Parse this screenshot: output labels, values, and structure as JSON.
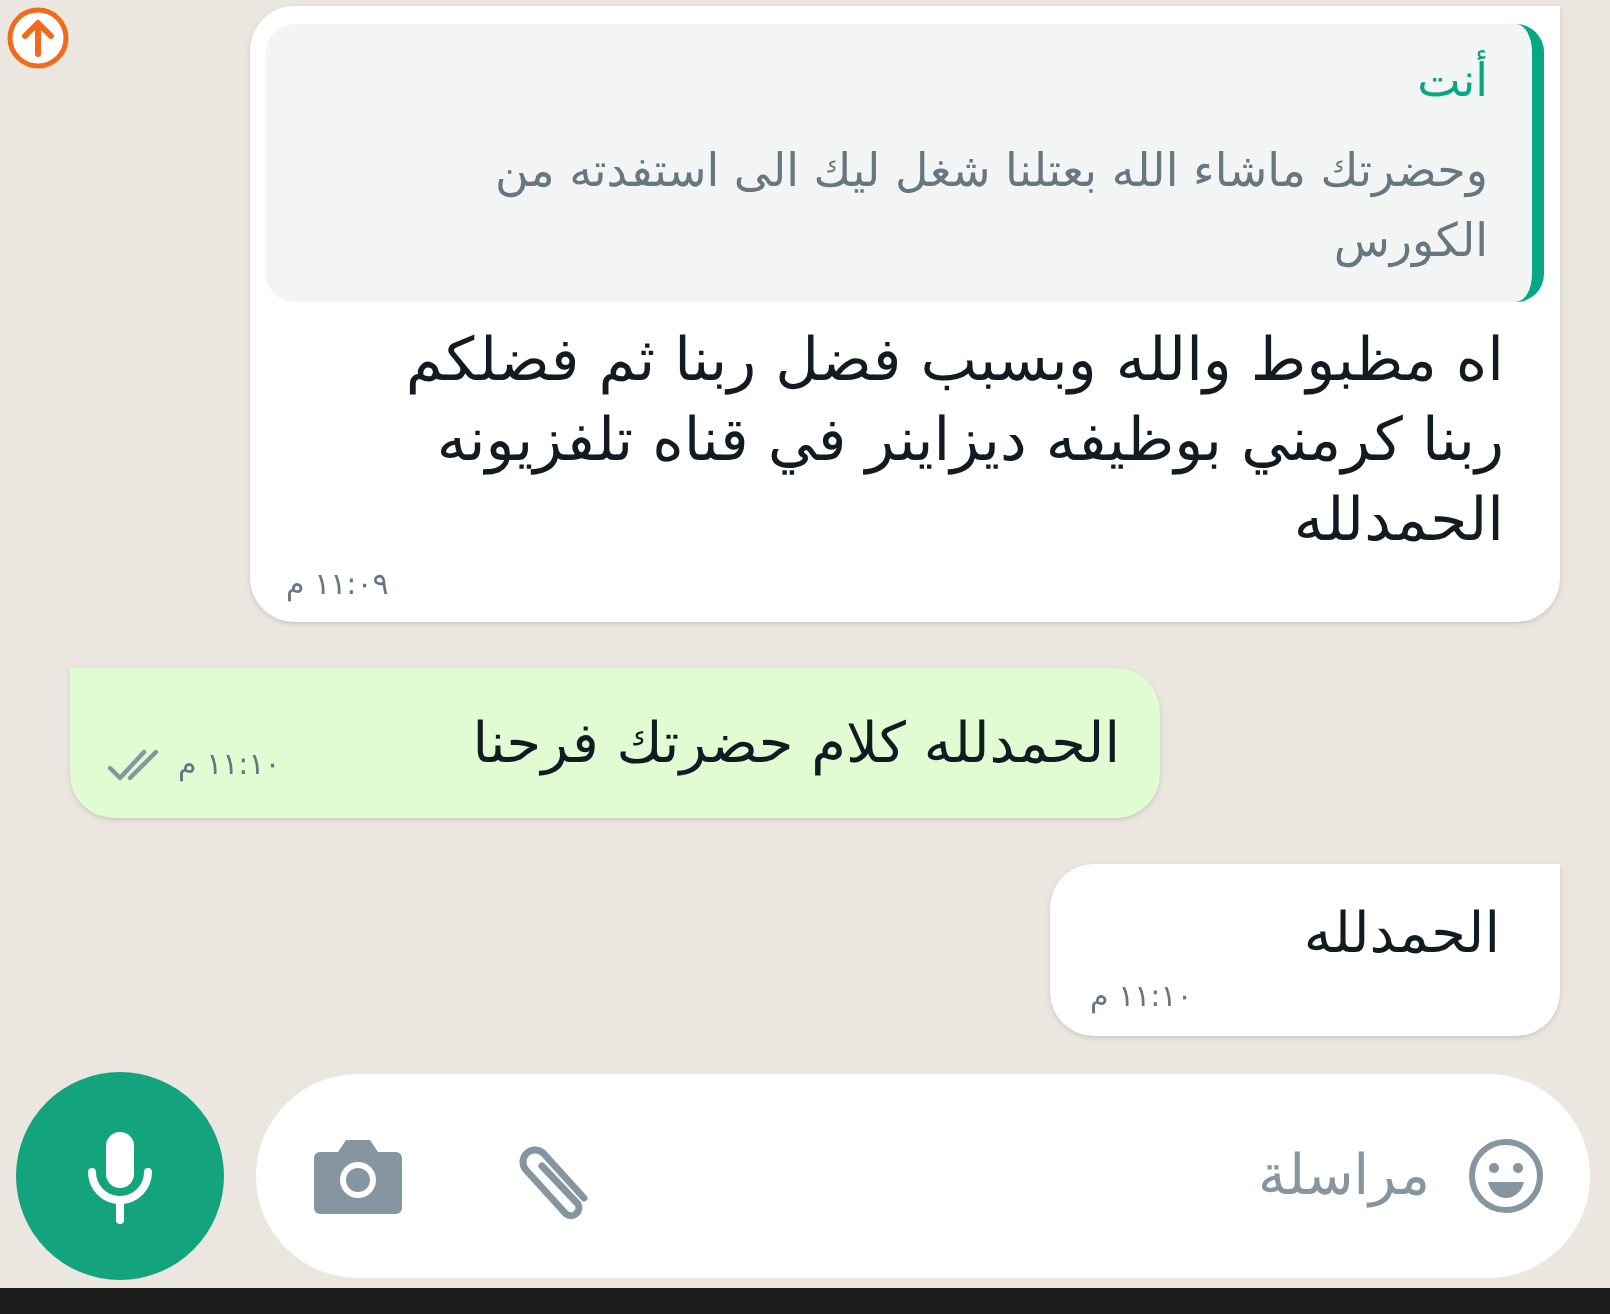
{
  "messages": [
    {
      "kind": "incoming",
      "quote": {
        "author": "أنت",
        "text": "وحضرتك ماشاء الله بعتلنا شغل ليك الى استفدته من الكورس"
      },
      "text": "اه مظبوط والله وبسبب فضل ربنا ثم فضلكم ربنا كرمني بوظيفه ديزاينر في قناه تلفزيونه الحمدلله",
      "time": "١١:٠٩ م"
    },
    {
      "kind": "outgoing",
      "text": "الحمدلله كلام حضرتك فرحنا",
      "time": "١١:١٠ م",
      "read": false
    },
    {
      "kind": "incoming",
      "text": "الحمدلله",
      "time": "١١:١٠ م"
    }
  ],
  "composer": {
    "placeholder": "مراسلة"
  }
}
